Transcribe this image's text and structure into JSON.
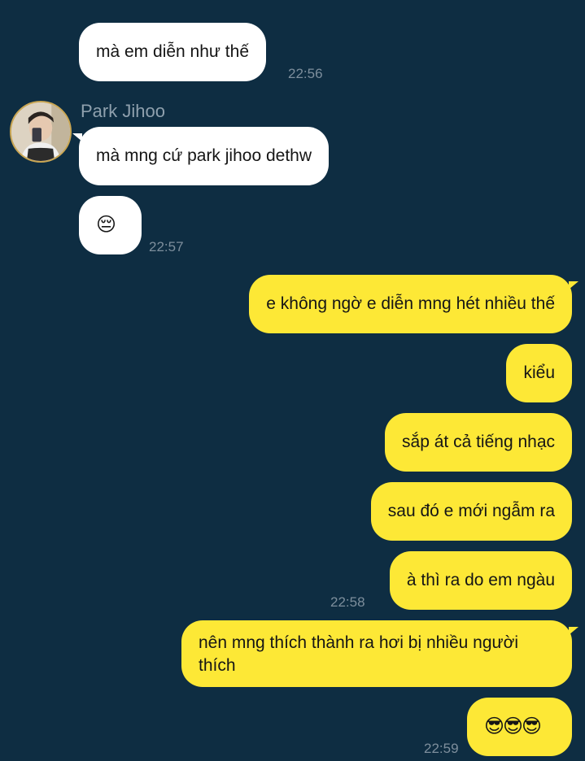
{
  "contact": {
    "name": "Park Jihoo"
  },
  "messages": [
    {
      "text": "mà em diễn như thế",
      "time": "22:56"
    },
    {
      "text": "mà mng cứ park jihoo dethw"
    },
    {
      "text": "😔",
      "time": "22:57"
    },
    {
      "text": "e không ngờ e diễn mng hét nhiều thế"
    },
    {
      "text": "kiểu"
    },
    {
      "text": "sắp át cả tiếng nhạc"
    },
    {
      "text": "sau đó e mới ngẫm ra"
    },
    {
      "text": "à thì ra do em ngàu",
      "time": "22:58"
    },
    {
      "text": "nên mng thích thành ra hơi bị nhiều người thích"
    },
    {
      "text": "😎😎😎",
      "time": "22:59"
    }
  ],
  "colors": {
    "background": "#0e2d42",
    "incoming_bubble": "#ffffff",
    "outgoing_bubble": "#fde836",
    "timestamp": "#7d8e9c",
    "sender_name": "#8fa0ad"
  }
}
